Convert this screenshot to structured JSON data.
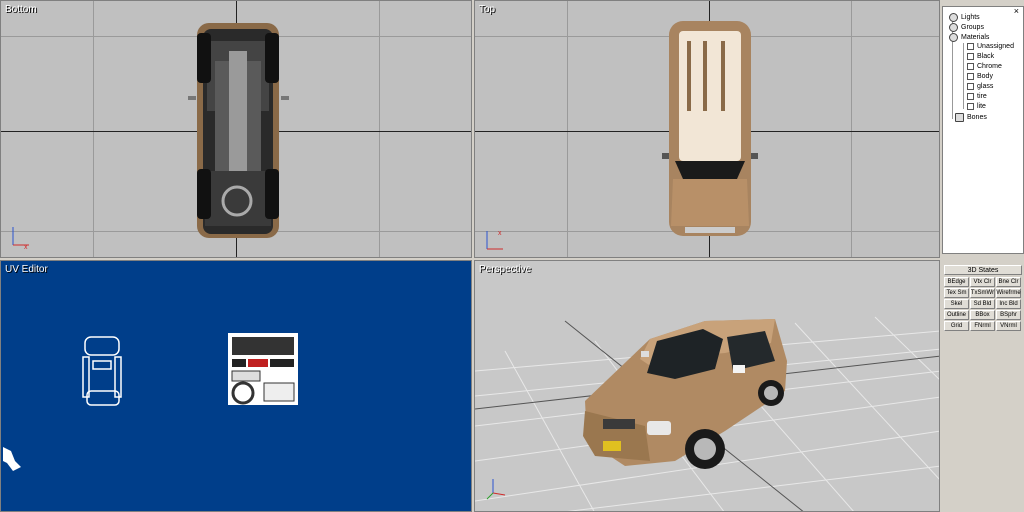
{
  "viewports": {
    "bottom": {
      "label": "Bottom"
    },
    "top": {
      "label": "Top"
    },
    "uv": {
      "label": "UV Editor"
    },
    "perspective": {
      "label": "Perspective"
    }
  },
  "tree": {
    "items": [
      {
        "label": "Lights",
        "icon": "light-icon"
      },
      {
        "label": "Groups",
        "icon": "groups-icon"
      },
      {
        "label": "Materials",
        "icon": "materials-icon"
      },
      {
        "label": "Unassigned",
        "icon": "material-box-icon"
      },
      {
        "label": "Black",
        "icon": "material-box-icon"
      },
      {
        "label": "Chrome",
        "icon": "material-box-icon"
      },
      {
        "label": "Body",
        "icon": "material-box-icon"
      },
      {
        "label": "glass",
        "icon": "material-box-icon"
      },
      {
        "label": "tire",
        "icon": "material-box-icon"
      },
      {
        "label": "lite",
        "icon": "material-box-icon"
      },
      {
        "label": "Bones",
        "icon": "bones-icon"
      }
    ],
    "close": "×"
  },
  "states": {
    "title": "3D States",
    "buttons": [
      "BEdge",
      "Vtx Clr",
      "Bne Clr",
      "Tex Sm",
      "TxSmWr",
      "Wirefrme",
      "Skel",
      "Sd Bld",
      "Inc Bld",
      "Outline",
      "BBox",
      "BSphr",
      "Grid",
      "FNrml",
      "VNrml"
    ]
  },
  "colors": {
    "uv_bg": "#003e8a",
    "viewport_bg": "#c0c0c0",
    "car_body": "#b08a63"
  }
}
